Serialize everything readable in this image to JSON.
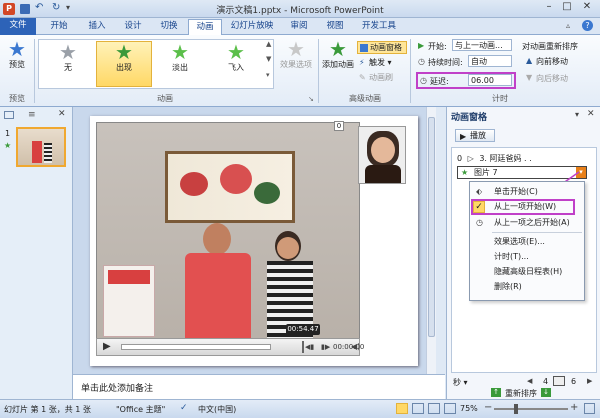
{
  "window": {
    "title": "演示文稿1.pptx - Microsoft PowerPoint"
  },
  "tabs": [
    "文件",
    "开始",
    "插入",
    "设计",
    "切换",
    "动画",
    "幻灯片放映",
    "审阅",
    "视图",
    "开发工具"
  ],
  "ribbon": {
    "preview_label": "预览",
    "preview_group": "预览",
    "effects": [
      {
        "label": "无",
        "color": "#9aa0a8"
      },
      {
        "label": "出现",
        "color": "#3a9a3a"
      },
      {
        "label": "淡出",
        "color": "#5bbf4a"
      },
      {
        "label": "飞入",
        "color": "#5bbf4a"
      }
    ],
    "effect_options": "效果选项",
    "animation_group": "动画",
    "add_animation": "添加动画",
    "animation_pane_btn": "动画窗格",
    "trigger_btn": "触发",
    "animation_painter": "动画刷",
    "advanced_group": "高级动画",
    "start_label": "开始:",
    "start_value": "与上一动画...",
    "duration_label": "持续时间:",
    "duration_value": "自动",
    "delay_label": "延迟:",
    "delay_value": "06.00",
    "reorder_title": "对动画重新排序",
    "move_earlier": "向前移动",
    "move_later": "向后移动",
    "timing_group": "计时"
  },
  "slides_panel": {
    "slide_number": "1"
  },
  "slide": {
    "badge": "0",
    "video_time": "00:54.47",
    "player_time": "00:00.00"
  },
  "notes": {
    "placeholder": "单击此处添加备注"
  },
  "anim_pane": {
    "title": "动画窗格",
    "play_btn": "播放",
    "item1_num": "0",
    "item1_label": "3. 阿廷爸妈 . .",
    "item2_label": "图片 7",
    "menu": [
      "单击开始(C)",
      "从上一项开始(W)",
      "从上一项之后开始(A)",
      "效果选项(E)...",
      "计时(T)...",
      "隐藏高级日程表(H)",
      "删除(R)"
    ],
    "seconds_label": "秒",
    "timeline_start": "4",
    "timeline_end": "6",
    "reorder_label": "重新排序"
  },
  "statusbar": {
    "slide_info": "幻灯片 第 1 张，共 1 张",
    "theme": "\"Office 主题\"",
    "language": "中文(中国)",
    "zoom": "75%"
  }
}
